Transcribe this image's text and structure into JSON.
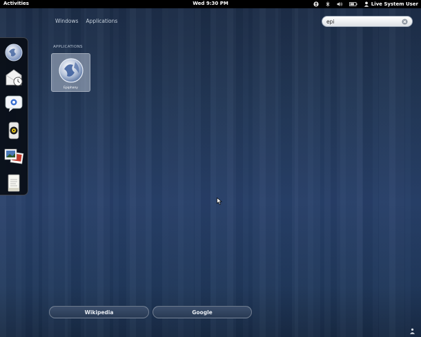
{
  "topbar": {
    "activities": "Activities",
    "clock": "Wed  9:30 PM",
    "user": "Live System User",
    "tray_icons": [
      "accessibility-icon",
      "network-icon",
      "volume-icon",
      "battery-icon",
      "user-icon"
    ]
  },
  "views": {
    "windows": "Windows",
    "applications": "Applications"
  },
  "search": {
    "value": "epi",
    "clear_icon": "clear-icon"
  },
  "dash": {
    "items": [
      "web-browser-icon",
      "mail-clock-icon",
      "chat-icon",
      "speaker-icon",
      "photos-icon",
      "documents-icon"
    ]
  },
  "results": {
    "section_label": "APPLICATIONS",
    "apps": [
      {
        "label": "Epiphany",
        "icon": "epiphany-icon"
      }
    ]
  },
  "providers": {
    "wikipedia": "Wikipedia",
    "google": "Google"
  },
  "colors": {
    "background": "#233858",
    "topbar": "#000000",
    "dash": "#080c14"
  }
}
